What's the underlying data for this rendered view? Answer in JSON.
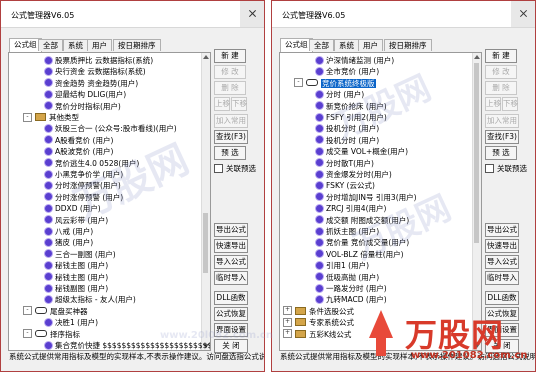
{
  "left": {
    "title": "公式管理器V6.05",
    "tabs": [
      "公式组",
      "全部",
      "系统",
      "用户",
      "按日期排序"
    ],
    "nodes": [
      {
        "t": "股票质押比 云数据指标(系统)",
        "icon": "gear",
        "d": 3
      },
      {
        "t": "央行资金 云数据指标(系统)",
        "icon": "gear",
        "d": 3
      },
      {
        "t": "资金趋势 资金趋势(用户)",
        "icon": "gear",
        "d": 3
      },
      {
        "t": "迎最结构 DLIG(用户)",
        "icon": "gear",
        "d": 3
      },
      {
        "t": "竞价分时指标(用户)",
        "icon": "gear",
        "d": 3
      },
      {
        "t": "其他类型",
        "icon": "folder",
        "d": 1,
        "exp": "-"
      },
      {
        "t": "妖股三合一 (公众号:股市看线)(用户)",
        "icon": "gear",
        "d": 3
      },
      {
        "t": "A股看竞价 (用户)",
        "icon": "gear",
        "d": 3
      },
      {
        "t": "A股波竞价 (用户)",
        "icon": "gear",
        "d": 3
      },
      {
        "t": "竞价逃生4.0 0528(用户)",
        "icon": "gear",
        "d": 3
      },
      {
        "t": "小黑竞争价学 (用户)",
        "icon": "gear",
        "d": 3
      },
      {
        "t": "分时涨停预警(用户)",
        "icon": "gear",
        "d": 3
      },
      {
        "t": "分时涨停预警 (用户)",
        "icon": "gear",
        "d": 3
      },
      {
        "t": "DDXD (用户)",
        "icon": "gear",
        "d": 3
      },
      {
        "t": "风云彩带 (用户)",
        "icon": "gear",
        "d": 3
      },
      {
        "t": "八戒 (用户)",
        "icon": "gear",
        "d": 3
      },
      {
        "t": "猪皮 (用户)",
        "icon": "gear",
        "d": 3
      },
      {
        "t": "三合一副图 (用户)",
        "icon": "gear",
        "d": 3
      },
      {
        "t": "秘钱主图 (用户)",
        "icon": "gear",
        "d": 3
      },
      {
        "t": "秘钱主图 (用户)",
        "icon": "gear",
        "d": 3
      },
      {
        "t": "秘钱副图 (用户)",
        "icon": "gear",
        "d": 3
      },
      {
        "t": "超级太指标 - 友人(用户)",
        "icon": "gear",
        "d": 3
      },
      {
        "t": "尾盘买神器",
        "icon": "link",
        "d": 1,
        "exp": "-"
      },
      {
        "t": "决胜1 (用户)",
        "icon": "gear",
        "d": 3
      },
      {
        "t": "择序指标",
        "icon": "link",
        "d": 1,
        "exp": "-"
      },
      {
        "t": "集合竞价快捷 $$$$$$$$$$$$$$$$$$$$$$$$$$$$",
        "icon": "gear",
        "d": 3
      }
    ],
    "buttons1": [
      "新 建",
      "修 改",
      "删 除"
    ],
    "order": [
      "上移",
      "下移"
    ],
    "buttons2": [
      "加入常用",
      "查找(F3)",
      "预 选"
    ],
    "checkbox": "关联预选",
    "buttons3": [
      "导出公式",
      "快速导出",
      "导入公式",
      "临时导入"
    ],
    "buttons4": [
      "DLL函数",
      "公式恢复",
      "界面设置",
      "关 闭"
    ],
    "status": "系统公式提供常用指标及模型的实现样本,不表示操作建议。访问盘选指公式说明区"
  },
  "right": {
    "title": "公式管理器V6.05",
    "tabs": [
      "公式组",
      "全部",
      "系统",
      "用户",
      "按日期排序"
    ],
    "nodes": [
      {
        "t": "沪深情绪监测 (用户)",
        "icon": "gear",
        "d": 3
      },
      {
        "t": "全市竞价 (用户)",
        "icon": "gear",
        "d": 3
      },
      {
        "t": "竞价系统终极版",
        "icon": "link",
        "d": 1,
        "exp": "-",
        "hl": true
      },
      {
        "t": "分时 (用户)",
        "icon": "gear",
        "d": 3
      },
      {
        "t": "新竞价抢床 (用户)",
        "icon": "gear",
        "d": 3
      },
      {
        "t": "FSFY 引用2(用户)",
        "icon": "gear",
        "d": 3
      },
      {
        "t": "投机分时 (用户)",
        "icon": "gear",
        "d": 3
      },
      {
        "t": "投机分时 (用户)",
        "icon": "gear",
        "d": 3
      },
      {
        "t": "成交量 VOL+概金(用户)",
        "icon": "gear",
        "d": 3
      },
      {
        "t": "分时散T(用户)",
        "icon": "gear",
        "d": 3
      },
      {
        "t": "资金爆发分时(用户)",
        "icon": "gear",
        "d": 3
      },
      {
        "t": "FSKY (云公式)",
        "icon": "gear",
        "d": 3
      },
      {
        "t": "分时增加JIN号 引用3(用户)",
        "icon": "gear",
        "d": 3
      },
      {
        "t": "ZRCJ 引用4(用户)",
        "icon": "gear",
        "d": 3
      },
      {
        "t": "成交额 附图成交额(用户)",
        "icon": "gear",
        "d": 3
      },
      {
        "t": "抓妖主图 (用户)",
        "icon": "gear",
        "d": 3
      },
      {
        "t": "竞价量 竞价成交量(用户)",
        "icon": "gear",
        "d": 3
      },
      {
        "t": "VOL-BLZ 倍量柱(用户)",
        "icon": "gear",
        "d": 3
      },
      {
        "t": "引用1 (用户)",
        "icon": "gear",
        "d": 3
      },
      {
        "t": "低吸高抛 (用户)",
        "icon": "gear",
        "d": 3
      },
      {
        "t": "一路发分时 (用户)",
        "icon": "gear",
        "d": 3
      },
      {
        "t": "九转MACD (用户)",
        "icon": "gear",
        "d": 3
      },
      {
        "t": "条件选股公式",
        "icon": "folder",
        "d": 0,
        "exp": "+"
      },
      {
        "t": "专家系统公式",
        "icon": "folder",
        "d": 0,
        "exp": "+"
      },
      {
        "t": "五彩K线公式",
        "icon": "folder",
        "d": 0,
        "exp": "+"
      }
    ],
    "buttons1": [
      "新 建",
      "修 改",
      "删 除"
    ],
    "order": [
      "上移",
      "下移"
    ],
    "buttons2": [
      "加入常用",
      "查找(F3)",
      "预 选"
    ],
    "checkbox": "关联预选",
    "buttons3": [
      "导出公式",
      "快速导出",
      "导入公式",
      "临时导入"
    ],
    "buttons4": [
      "DLL函数",
      "公式恢复",
      "界面设置",
      "关 闭"
    ],
    "status": "系统公式提供常用指标及模型的实现样本,不表示操作建议。访问选指公式说明区"
  },
  "watermark": {
    "brand": "万股网",
    "url": "www.20l082.com.cn",
    "logo": "万股网",
    "logo_url": "www.201082.com.cn"
  },
  "colors": {
    "frame": "#b04040",
    "highlight": "#0a64c8",
    "gear": "#5a3fd0",
    "logo": "#d83a2a"
  }
}
